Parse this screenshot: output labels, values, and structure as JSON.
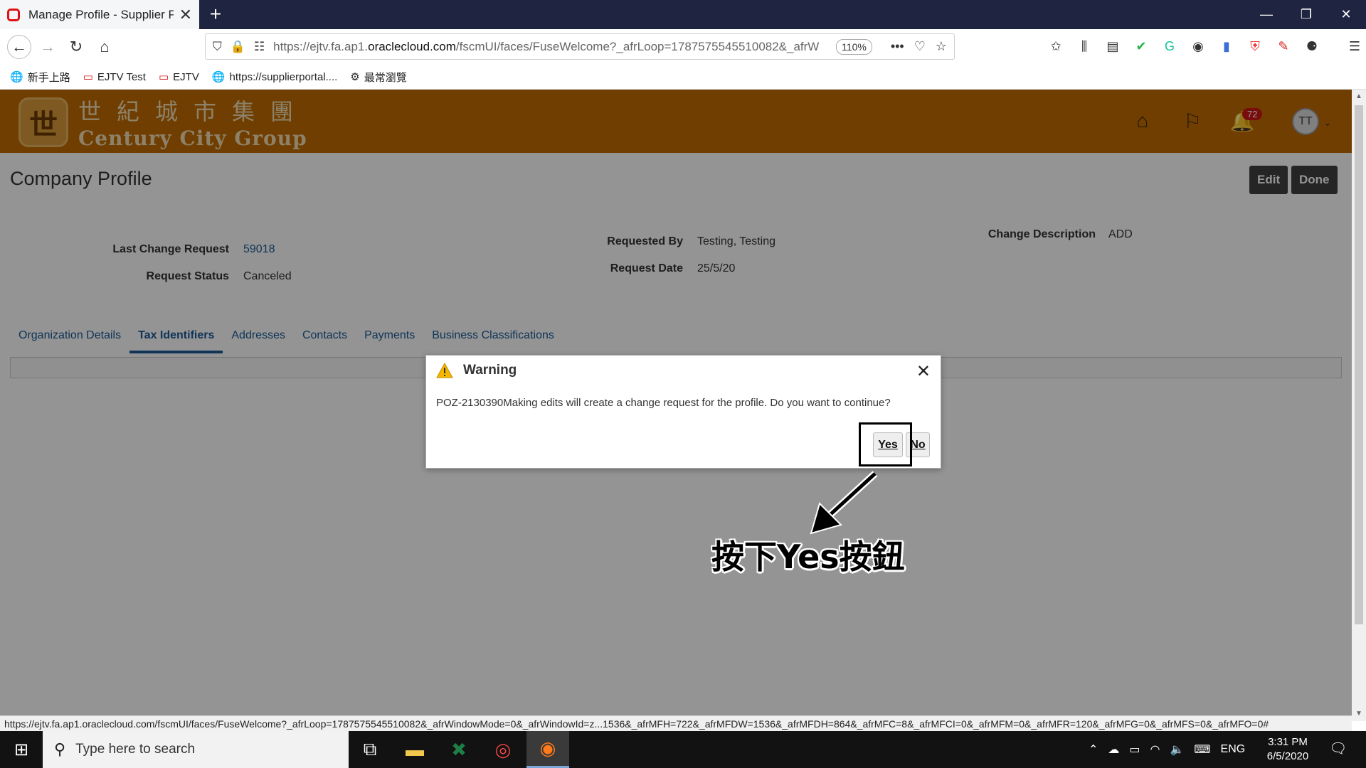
{
  "browser": {
    "tab_title": "Manage Profile - Supplier Porta",
    "new_tab": "+",
    "url_prefix": "https://ejtv.fa.ap1.",
    "url_domain": "oraclecloud.com",
    "url_rest": "/fscmUI/faces/FuseWelcome?_afrLoop=1787575545510082&_afrW",
    "zoom": "110%",
    "more": "•••"
  },
  "bookmarks": [
    {
      "label": "新手上路",
      "icon": "globe-icon"
    },
    {
      "label": "EJTV Test",
      "icon": "oracle-icon"
    },
    {
      "label": "EJTV",
      "icon": "oracle-icon"
    },
    {
      "label": "https://supplierportal....",
      "icon": "globe-icon"
    },
    {
      "label": "最常瀏覽",
      "icon": "gear-icon"
    }
  ],
  "header": {
    "logo_cn": "世紀城市集團",
    "logo_en": "Century City Group",
    "notification_count": "72",
    "avatar_initials": "TT"
  },
  "page": {
    "title": "Company Profile",
    "edit_label": "Edit",
    "done_label": "Done",
    "last_change_request_label": "Last Change Request",
    "last_change_request_value": "59018",
    "request_status_label": "Request Status",
    "request_status_value": "Canceled",
    "requested_by_label": "Requested By",
    "requested_by_value": "Testing, Testing",
    "request_date_label": "Request Date",
    "request_date_value": "25/5/20",
    "change_description_label": "Change Description",
    "change_description_value": "ADD",
    "tabs": [
      {
        "label": "Organization Details",
        "active": false
      },
      {
        "label": "Tax Identifiers",
        "active": true
      },
      {
        "label": "Addresses",
        "active": false
      },
      {
        "label": "Contacts",
        "active": false
      },
      {
        "label": "Payments",
        "active": false
      },
      {
        "label": "Business Classifications",
        "active": false
      }
    ]
  },
  "dialog": {
    "title": "Warning",
    "message": "POZ-2130390Making edits will create a change request for the profile. Do you want to continue?",
    "yes_label": "Yes",
    "no_label": "No"
  },
  "annotation": {
    "text": "按下Yes按鈕"
  },
  "status_url": "https://ejtv.fa.ap1.oraclecloud.com/fscmUI/faces/FuseWelcome?_afrLoop=1787575545510082&_afrWindowMode=0&_afrWindowId=z...1536&_afrMFH=722&_afrMFDW=1536&_afrMFDH=864&_afrMFC=8&_afrMFCI=0&_afrMFM=0&_afrMFR=120&_afrMFG=0&_afrMFS=0&_afrMFO=0#",
  "taskbar": {
    "search_placeholder": "Type here to search",
    "language": "ENG",
    "time": "3:31 PM",
    "date": "6/5/2020"
  },
  "colors": {
    "header_orange": "#c26b00",
    "link_blue": "#1a5a96",
    "badge_red": "#d01818"
  }
}
